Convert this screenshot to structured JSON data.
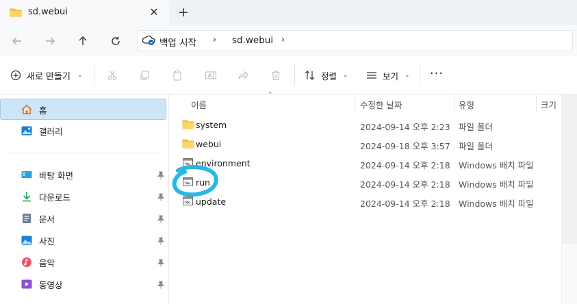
{
  "tab": {
    "title": "sd.webui",
    "close": "✕",
    "new_tab": "+"
  },
  "address": {
    "segments": [
      "백업 시작",
      "sd.webui"
    ],
    "separator": "›"
  },
  "toolbar": {
    "new_label": "새로 만들기",
    "sort_label": "정렬",
    "view_label": "보기",
    "more": "···",
    "chevron": "⌄"
  },
  "sidebar": {
    "items": [
      {
        "label": "홈",
        "icon": "home-icon"
      },
      {
        "label": "갤러리",
        "icon": "gallery-icon"
      },
      {
        "label": "바탕 화면",
        "icon": "desktop-icon",
        "pinned": true
      },
      {
        "label": "다운로드",
        "icon": "download-icon",
        "pinned": true
      },
      {
        "label": "문서",
        "icon": "documents-icon",
        "pinned": true
      },
      {
        "label": "사진",
        "icon": "pictures-icon",
        "pinned": true
      },
      {
        "label": "음악",
        "icon": "music-icon",
        "pinned": true
      },
      {
        "label": "동영상",
        "icon": "videos-icon",
        "pinned": true
      }
    ]
  },
  "columns": {
    "name": "이름",
    "date": "수정한 날짜",
    "type": "유형",
    "size": "크기"
  },
  "files": [
    {
      "name": "system",
      "date": "2024-09-14 오후 2:23",
      "type": "파일 폴더",
      "icon": "folder-icon"
    },
    {
      "name": "webui",
      "date": "2024-09-18 오후 3:57",
      "type": "파일 폴더",
      "icon": "folder-icon"
    },
    {
      "name": "environment",
      "date": "2024-09-14 오후 2:18",
      "type": "Windows 배치 파일",
      "icon": "batch-file-icon"
    },
    {
      "name": "run",
      "date": "2024-09-14 오후 2:18",
      "type": "Windows 배치 파일",
      "icon": "batch-file-icon"
    },
    {
      "name": "update",
      "date": "2024-09-14 오후 2:18",
      "type": "Windows 배치 파일",
      "icon": "batch-file-icon"
    }
  ],
  "colors": {
    "accent": "#0067c0",
    "selection": "#cde6f7",
    "highlight_circle": "#27b8e6",
    "folder": "#f4c542"
  }
}
